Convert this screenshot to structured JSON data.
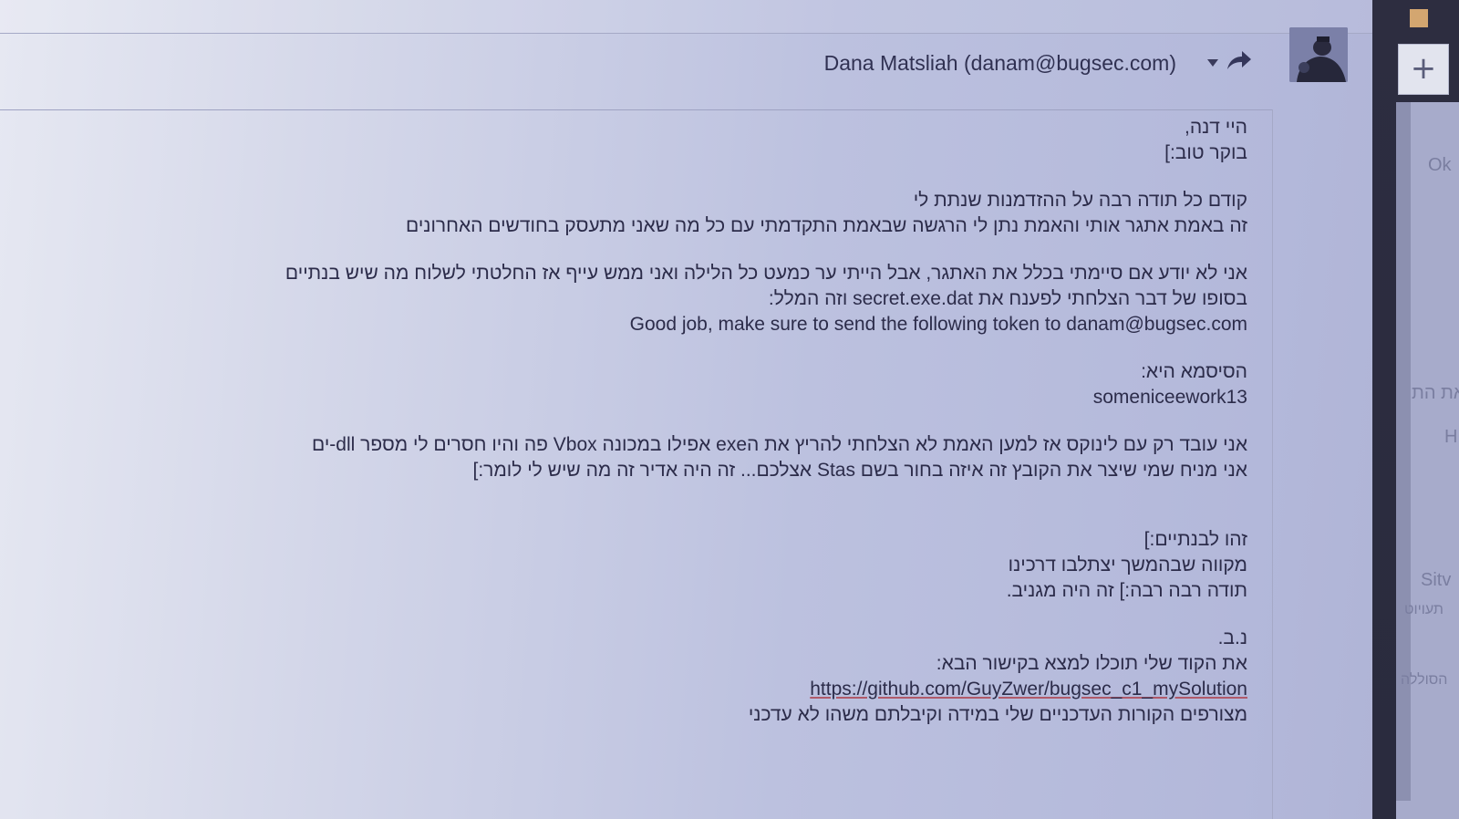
{
  "header": {
    "sender": "Dana Matsliah (danam@bugsec.com)"
  },
  "message": {
    "lines": [
      "היי דנה,",
      "בוקר טוב:]",
      "",
      "קודם כל תודה רבה על ההזדמנות שנתת לי",
      "זה באמת אתגר אותי והאמת נתן לי הרגשה שבאמת התקדמתי עם כל מה שאני מתעסק בחודשים האחרונים",
      "",
      "אני לא יודע אם סיימתי בכלל את האתגר, אבל הייתי ער כמעט כל הלילה ואני ממש עייף אז החלטתי לשלוח מה שיש בנתיים",
      "בסופו של דבר הצלחתי לפענח את secret.exe.dat וזה המלל:",
      "Good job, make sure to send the following token to danam@bugsec.com",
      "",
      "הסיסמא היא:",
      "someniceework13",
      "",
      "אני עובד רק עם לינוקס אז למען האמת לא הצלחתי להריץ את הexe אפילו במכונה Vbox פה והיו חסרים לי מספר dll-ים",
      "אני מניח שמי שיצר את הקובץ זה איזה בחור בשם Stas אצלכם... זה היה אדיר זה מה שיש לי לומר:]",
      "",
      "",
      "זהו לבנתיים:]",
      "מקווה שבהמשך יצתלבו דרכינו",
      "תודה רבה רבה:] זה היה מגניב.",
      "",
      "נ.ב.",
      "את הקוד שלי תוכלו למצא בקישור הבא:",
      "https://github.com/GuyZwer/bugsec_c1_mySolution",
      "מצורפים הקורות העדכניים שלי במידה וקיבלתם משהו לא עדכני"
    ]
  },
  "sidebar": {
    "compose_label": "+",
    "labels": [
      "Ok",
      "את הת",
      "H",
      "Sitv",
      "תעויוט",
      "הסוללה"
    ]
  },
  "colors": {
    "text": "#2c2c4a",
    "panel": "#2d2d40",
    "accent": "#d3a670"
  },
  "icons": {
    "reply": "reply-arrow-icon",
    "more": "caret-down-icon",
    "compose": "plus-icon"
  }
}
